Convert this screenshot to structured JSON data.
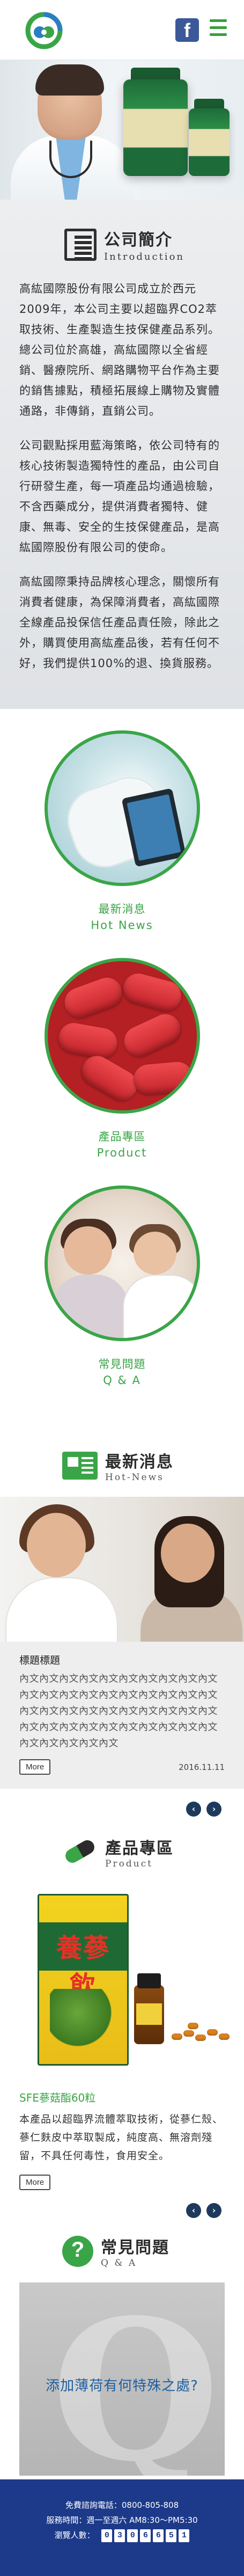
{
  "header": {
    "logo_icon": "company-logo-icon",
    "facebook_icon": "facebook-icon",
    "menu_icon": "hamburger-menu-icon"
  },
  "intro": {
    "title": "公司簡介",
    "subtitle": "Introduction",
    "paragraphs": [
      "高紘國際股份有限公司成立於西元2009年，本公司主要以超臨界CO2萃取技術、生產製造生技保健產品系列。總公司位於高雄，高紘國際以全省經銷、醫療院所、網路購物平台作為主要的銷售據點，積極拓展線上購物及實體通路，非傳銷，直銷公司。",
      "公司觀點採用藍海策略，依公司特有的核心技術製造獨特性的產品，由公司自行研發生產，每一項產品均通過檢驗，不含西藥成分，提供消費者獨特、健康、無毒、安全的生技保健產品，是高紘國際股份有限公司的使命。",
      "高紘國際秉持品牌核心理念，關懷所有消費者健康，為保障消費者，高紘國際全線產品投保信任產品責任險，除此之外，購買使用高紘產品後，若有任何不好，我們提供100%的退、換貨服務。"
    ]
  },
  "circles": [
    {
      "label": "最新消息",
      "sublabel": "Hot News"
    },
    {
      "label": "產品專區",
      "sublabel": "Product"
    },
    {
      "label": "常見問題",
      "sublabel": "Q & A"
    }
  ],
  "news": {
    "title": "最新消息",
    "subtitle": "Hot-News",
    "item_title": "標題標題",
    "item_body": "內文內文內文內文內文內文內文內文內文內文內文內文內文內文內文內文內文內文內文內文內文內文內文內文內文內文內文內文內文內文內文內文內文內文內文內文內文內文內文內文內文內文內文內文內文",
    "more": "More",
    "date": "2016.11.11"
  },
  "product": {
    "title": "產品專區",
    "subtitle": "Product",
    "box_text": "養蔘飲",
    "name": "SFE蔘菇酯60粒",
    "desc": "本產品以超臨界流體萃取技術，從蔘仁殼、蔘仁麩皮中萃取製成，純度高、無溶劑殘留，不具任何毒性，食用安全。",
    "more": "More"
  },
  "qa": {
    "title": "常見問題",
    "subtitle": "Q & A",
    "question": "添加薄荷有何特殊之處?"
  },
  "pager": {
    "prev": "‹",
    "next": "›"
  },
  "footer": {
    "hotline": "免費諮詢電話：0800-805-808",
    "hours": "服務時間：週一至週六 AM8:30～PM5:30",
    "visitor_label": "瀏覽人數：",
    "visitor_digits": [
      "0",
      "3",
      "0",
      "6",
      "6",
      "5",
      "1"
    ]
  },
  "colors": {
    "accent_green": "#3aa547",
    "footer_blue": "#1d3a8a",
    "link_blue": "#1f5fa0"
  }
}
